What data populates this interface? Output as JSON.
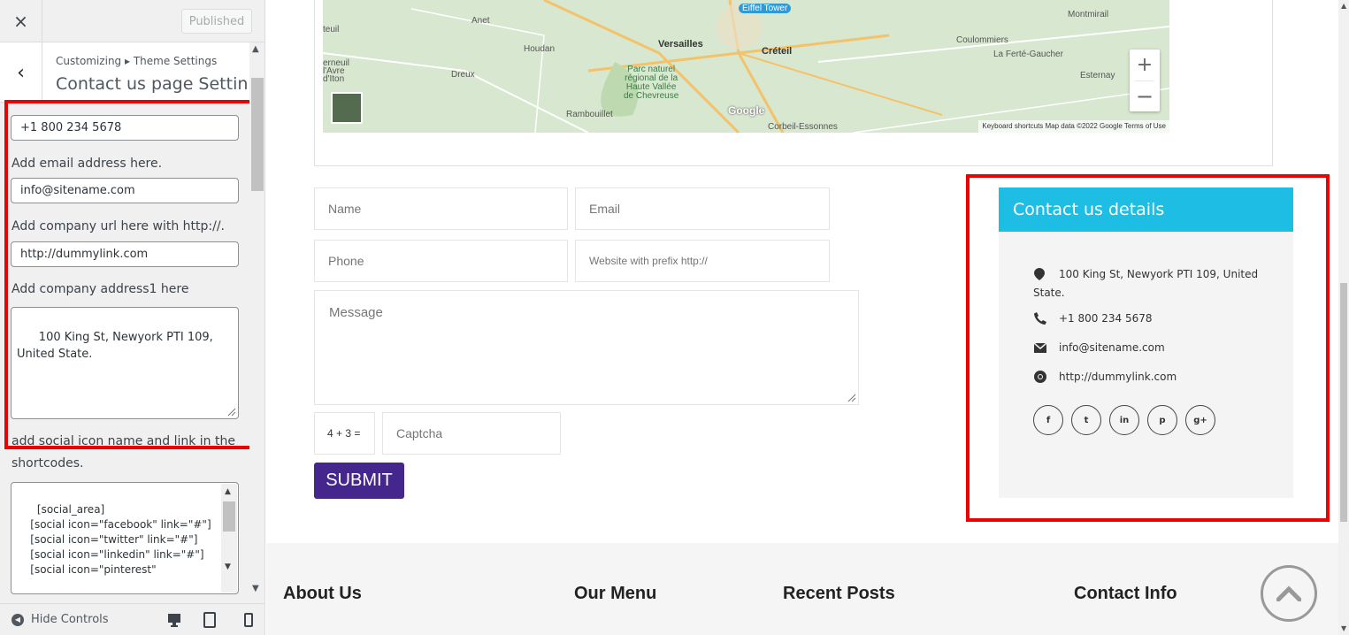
{
  "customizer": {
    "close_icon": "×",
    "publish_label": "Published",
    "back_icon": "‹",
    "breadcrumb": "Customizing ▸ Theme Settings",
    "section_title": "Contact us page Settin...",
    "fields": {
      "phone_value": "+1 800 234 5678",
      "email_label": "Add email address here.",
      "email_value": "info@sitename.com",
      "url_label": "Add company url here with http://.",
      "url_value": "http://dummylink.com",
      "address_label": "Add company address1 here",
      "address_value": "100 King St, Newyork PTI 109, United State.",
      "social_label_line1": "add social icon name and link in the",
      "social_label_line2": "shortcodes.",
      "shortcodes": "[social_area]\n    [social icon=\"facebook\" link=\"#\"]\n    [social icon=\"twitter\" link=\"#\"]\n    [social icon=\"linkedin\" link=\"#\"]\n    [social icon=\"pinterest\""
    },
    "footer": {
      "hide_controls": "Hide Controls",
      "devices": [
        "desktop-icon",
        "tablet-icon",
        "mobile-icon"
      ]
    }
  },
  "preview": {
    "map": {
      "labels": {
        "eiffel": "Eiffel Tower",
        "versailles": "Versailles",
        "creteil": "Créteil",
        "houdan": "Houdan",
        "anet": "Anet",
        "dreux": "Dreux",
        "rambouillet": "Rambouillet",
        "parc": "Parc naturel\nrégional de la\nHaute Vallée\nde Chevreuse",
        "montmirail": "Montmirail",
        "coulommiers": "Coulommiers",
        "ferte": "La Ferté-Gaucher",
        "esternay": "Esternay",
        "corbeil": "Corbeil-Essonnes",
        "verneuil": "erneuil\nl'Avre\nd'Iton",
        "teuil": "teuil"
      },
      "zoom_in": "+",
      "zoom_out": "−",
      "google": "Google",
      "attribution": "Keyboard shortcuts   Map data ©2022 Google   Terms of Use"
    },
    "form": {
      "name_placeholder": "Name",
      "email_placeholder": "Email",
      "phone_placeholder": "Phone",
      "website_placeholder": "Website with prefix http://",
      "message_placeholder": "Message",
      "captcha_question": "4 + 3 =",
      "captcha_placeholder": "Captcha",
      "submit_label": "SUBMIT"
    },
    "contact_card": {
      "title": "Contact us details",
      "address": "100 King St, Newyork PTI 109, United State.",
      "phone": "+1 800 234 5678",
      "email": "info@sitename.com",
      "website": "http://dummylink.com",
      "socials": [
        "f",
        "t",
        "in",
        "p",
        "g+"
      ]
    },
    "footer_headings": {
      "about": "About Us",
      "menu": "Our Menu",
      "posts": "Recent Posts",
      "contact": "Contact Info"
    }
  },
  "colors": {
    "accent_card": "#1ebde3",
    "submit": "#44268c",
    "highlight": "#e00000"
  }
}
